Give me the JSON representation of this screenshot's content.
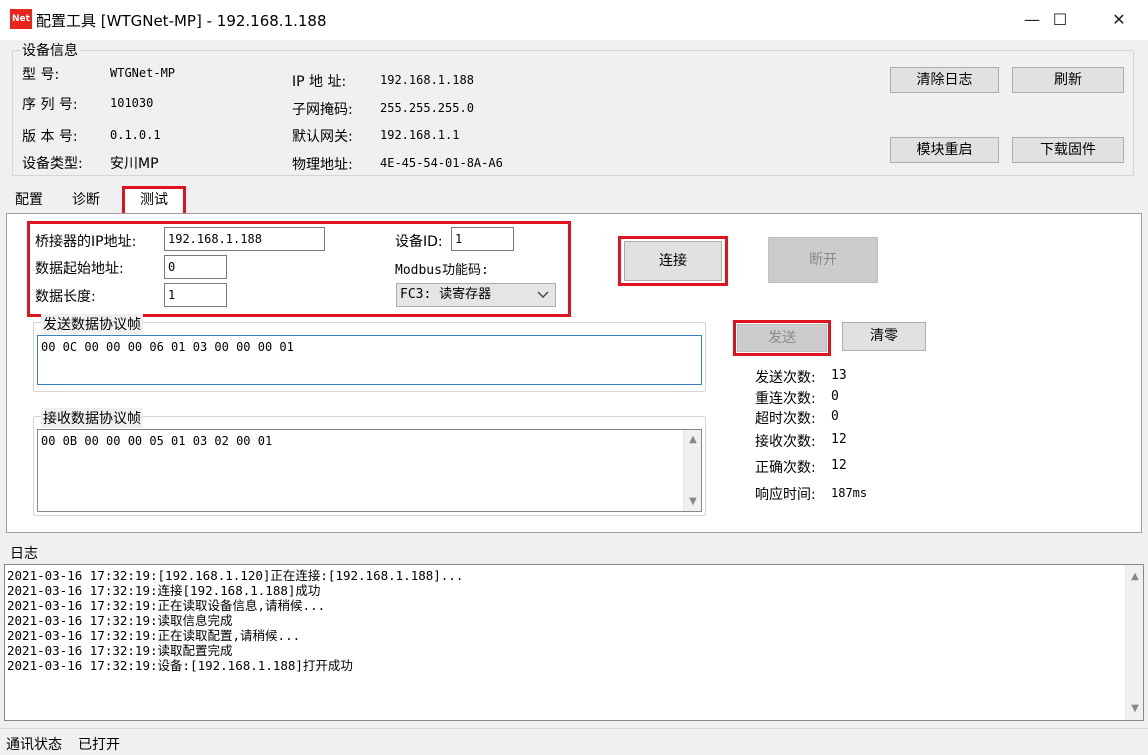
{
  "window": {
    "app_icon_text": "Net",
    "title": "配置工具 [WTGNet-MP] - 192.168.1.188",
    "minimize": "—",
    "maximize": "☐",
    "close": "✕"
  },
  "device_info": {
    "group_title": "设备信息",
    "model_label": "型    号:",
    "model_value": "WTGNet-MP",
    "serial_label": "序 列 号:",
    "serial_value": "101030",
    "version_label": "版 本 号:",
    "version_value": "0.1.0.1",
    "type_label": "设备类型:",
    "type_value": "安川MP",
    "ip_label": "IP 地 址:",
    "ip_value": "192.168.1.188",
    "mask_label": "子网掩码:",
    "mask_value": "255.255.255.0",
    "gateway_label": "默认网关:",
    "gateway_value": "192.168.1.1",
    "mac_label": "物理地址:",
    "mac_value": "4E-45-54-01-8A-A6"
  },
  "toolbar": {
    "clear_log": "清除日志",
    "refresh": "刷新",
    "restart": "模块重启",
    "download_fw": "下载固件"
  },
  "tabs": [
    "配置",
    "诊断",
    "测试"
  ],
  "test": {
    "bridge_ip_label": "桥接器的IP地址:",
    "bridge_ip_value": "192.168.1.188",
    "start_addr_label": "数据起始地址:",
    "start_addr_value": "0",
    "length_label": "数据长度:",
    "length_value": "1",
    "device_id_label": "设备ID:",
    "device_id_value": "1",
    "modbus_fc_label": "Modbus功能码:",
    "modbus_fc_value": "FC3: 读寄存器",
    "connect": "连接",
    "disconnect": "断开",
    "send_frame_title": "发送数据协议帧",
    "send_frame_value": "00 0C 00 00 00 06 01 03 00 00 00 01",
    "recv_frame_title": "接收数据协议帧",
    "recv_frame_value": "00 0B 00 00 00 05 01 03 02 00 01",
    "send": "发送",
    "clear": "清零",
    "stats": [
      {
        "label": "发送次数:",
        "value": "13"
      },
      {
        "label": "重连次数:",
        "value": "0"
      },
      {
        "label": "超时次数:",
        "value": "0"
      },
      {
        "label": "接收次数:",
        "value": "12"
      },
      {
        "label": "正确次数:",
        "value": "12"
      },
      {
        "label": "响应时间:",
        "value": "187ms"
      }
    ]
  },
  "log": {
    "title": "日志",
    "lines": [
      "2021-03-16 17:32:19:[192.168.1.120]正在连接:[192.168.1.188]...",
      "2021-03-16 17:32:19:连接[192.168.1.188]成功",
      "2021-03-16 17:32:19:正在读取设备信息,请稍候...",
      "2021-03-16 17:32:19:读取信息完成",
      "2021-03-16 17:32:19:正在读取配置,请稍候...",
      "2021-03-16 17:32:19:读取配置完成",
      "2021-03-16 17:32:19:设备:[192.168.1.188]打开成功"
    ]
  },
  "status": {
    "label": "通讯状态",
    "value": "已打开"
  },
  "colors": {
    "highlight_red": "#e0141e",
    "app_icon_red": "#e8261e"
  },
  "icons": [
    "app-icon",
    "minimize-icon",
    "maximize-icon",
    "close-icon",
    "scroll-up-arrow-icon",
    "scroll-down-arrow-icon",
    "chevron-down-icon"
  ]
}
